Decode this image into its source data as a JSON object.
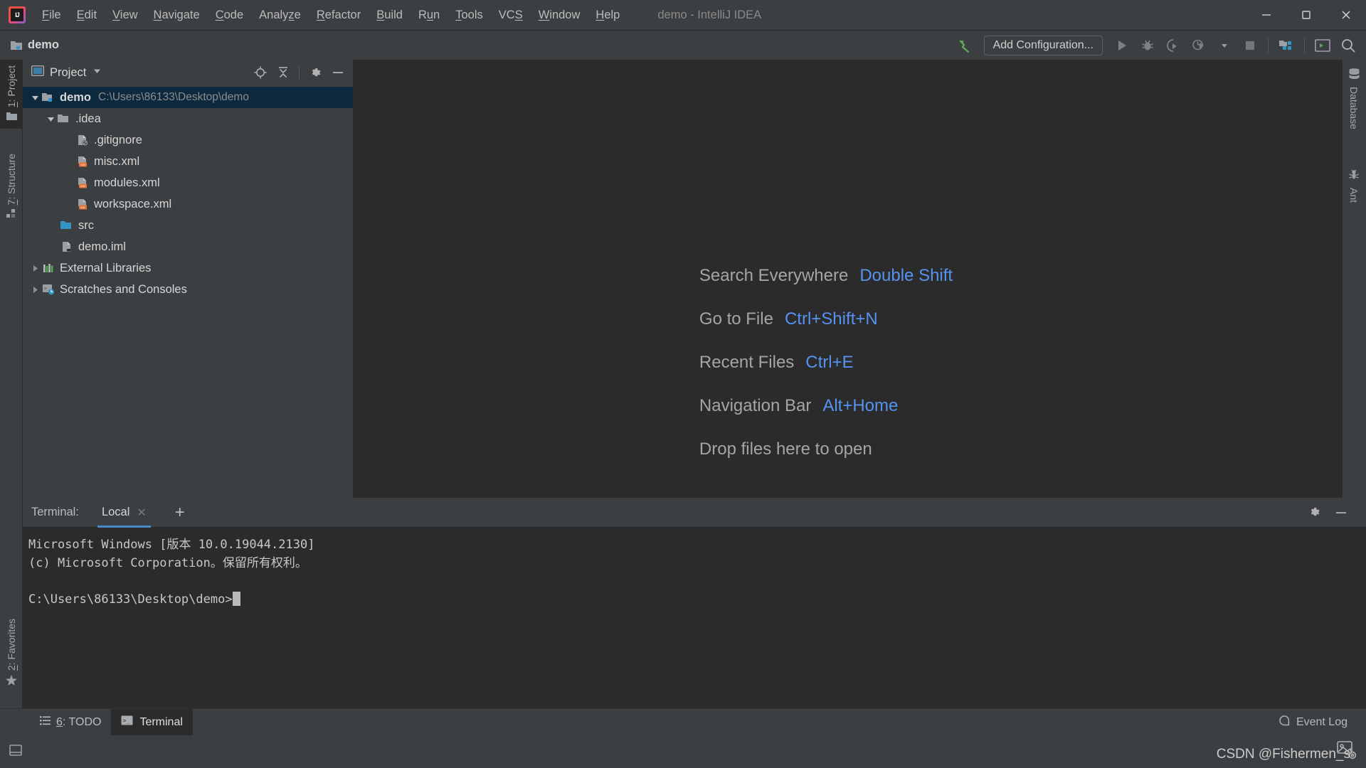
{
  "window": {
    "title": "demo - IntelliJ IDEA",
    "logo_icon": "intellij-idea-logo-icon",
    "minimize_icon": "minimize-icon",
    "maximize_icon": "maximize-icon",
    "close_icon": "close-icon"
  },
  "menu": {
    "items": [
      {
        "label": "File",
        "mnemonic": "F"
      },
      {
        "label": "Edit",
        "mnemonic": "E"
      },
      {
        "label": "View",
        "mnemonic": "V"
      },
      {
        "label": "Navigate",
        "mnemonic": "N"
      },
      {
        "label": "Code",
        "mnemonic": "C"
      },
      {
        "label": "Analyze",
        "mnemonic": "z"
      },
      {
        "label": "Refactor",
        "mnemonic": "R"
      },
      {
        "label": "Build",
        "mnemonic": "B"
      },
      {
        "label": "Run",
        "mnemonic": "u"
      },
      {
        "label": "Tools",
        "mnemonic": "T"
      },
      {
        "label": "VCS",
        "mnemonic": "S"
      },
      {
        "label": "Window",
        "mnemonic": "W"
      },
      {
        "label": "Help",
        "mnemonic": "H"
      }
    ]
  },
  "toolbar": {
    "project_name": "demo",
    "project_icon": "project-folder-icon",
    "build_icon": "build-hammer-icon",
    "add_configuration_label": "Add Configuration...",
    "run_icon": "run-play-icon",
    "debug_icon": "debug-bug-icon",
    "coverage_icon": "run-with-coverage-icon",
    "profile_icon": "profile-icon",
    "profile_dropdown_icon": "chevron-down-icon",
    "stop_icon": "stop-icon",
    "project_structure_icon": "project-structure-icon",
    "terminal_icon": "terminal-icon",
    "search_icon": "search-icon"
  },
  "left_tool_strip": {
    "items": [
      {
        "label": "1: Project",
        "mnemonic": "1",
        "icon": "project-panel-icon",
        "active": true
      },
      {
        "label": "7: Structure",
        "mnemonic": "7",
        "icon": "structure-icon",
        "active": false
      },
      {
        "label": "2: Favorites",
        "mnemonic": "2",
        "icon": "favorites-star-icon",
        "active": false
      }
    ]
  },
  "right_tool_strip": {
    "items": [
      {
        "label": "Database",
        "icon": "database-icon"
      },
      {
        "label": "Ant",
        "icon": "ant-bug-icon"
      }
    ]
  },
  "project_panel": {
    "title": "Project",
    "dropdown_icon": "chevron-down-icon",
    "panel_icon": "project-panel-icon",
    "locate_icon": "locate-target-icon",
    "collapse_all_icon": "collapse-all-icon",
    "settings_icon": "gear-icon",
    "hide_icon": "hide-minimize-icon",
    "tree": [
      {
        "name": "demo",
        "path": "C:\\Users\\86133\\Desktop\\demo",
        "icon": "module-folder-icon",
        "indent": 0,
        "twisty": "down",
        "selected": true,
        "bold": true
      },
      {
        "name": ".idea",
        "path": "",
        "icon": "folder-icon",
        "indent": 1,
        "twisty": "down",
        "selected": false,
        "bold": false
      },
      {
        "name": ".gitignore",
        "path": "",
        "icon": "gitignore-file-icon",
        "indent": 2,
        "twisty": "none",
        "selected": false,
        "bold": false
      },
      {
        "name": "misc.xml",
        "path": "",
        "icon": "xml-file-icon",
        "indent": 2,
        "twisty": "none",
        "selected": false,
        "bold": false
      },
      {
        "name": "modules.xml",
        "path": "",
        "icon": "xml-file-icon",
        "indent": 2,
        "twisty": "none",
        "selected": false,
        "bold": false
      },
      {
        "name": "workspace.xml",
        "path": "",
        "icon": "xml-file-icon",
        "indent": 2,
        "twisty": "none",
        "selected": false,
        "bold": false
      },
      {
        "name": "src",
        "path": "",
        "icon": "source-folder-icon",
        "indent": 1,
        "twisty": "none",
        "selected": false,
        "bold": false
      },
      {
        "name": "demo.iml",
        "path": "",
        "icon": "iml-file-icon",
        "indent": 1,
        "twisty": "none",
        "selected": false,
        "bold": false
      },
      {
        "name": "External Libraries",
        "path": "",
        "icon": "libraries-icon",
        "indent": 0,
        "twisty": "right",
        "selected": false,
        "bold": false
      },
      {
        "name": "Scratches and Consoles",
        "path": "",
        "icon": "scratches-icon",
        "indent": 0,
        "twisty": "right",
        "selected": false,
        "bold": false
      }
    ]
  },
  "welcome": {
    "shortcuts": [
      {
        "label": "Search Everywhere",
        "key": "Double Shift"
      },
      {
        "label": "Go to File",
        "key": "Ctrl+Shift+N"
      },
      {
        "label": "Recent Files",
        "key": "Ctrl+E"
      },
      {
        "label": "Navigation Bar",
        "key": "Alt+Home"
      },
      {
        "label": "Drop files here to open",
        "key": ""
      }
    ]
  },
  "terminal": {
    "label": "Terminal:",
    "tab_name": "Local",
    "close_tab_icon": "close-icon",
    "new_tab_icon": "plus-icon",
    "settings_icon": "gear-icon",
    "hide_icon": "hide-minimize-icon",
    "lines": [
      "Microsoft Windows [版本 10.0.19044.2130]",
      "(c) Microsoft Corporation。保留所有权利。",
      "",
      "C:\\Users\\86133\\Desktop\\demo>"
    ]
  },
  "statusbar": {
    "tabs": [
      {
        "label": "6: TODO",
        "mnemonic": "6",
        "icon": "todo-list-icon",
        "active": false
      },
      {
        "label": "Terminal",
        "mnemonic": "",
        "icon": "terminal-icon",
        "active": true
      }
    ],
    "event_log_label": "Event Log",
    "event_log_icon": "event-log-icon"
  },
  "bottom": {
    "icon": "layout-toggle-icon",
    "watermark": "CSDN @Fishermen_s",
    "watermark_icon": "image-gear-icon"
  },
  "colors": {
    "background": "#3c3f41",
    "editor_background": "#2b2b2b",
    "selection": "#0d293e",
    "accent_blue": "#5693f0",
    "tab_underline": "#4a88c7",
    "text": "#d6d6d6",
    "muted_text": "#8d8d8d",
    "accent_red": "#f05a4f",
    "xml_icon": "#e8743b",
    "folder_blue": "#3592c4"
  }
}
